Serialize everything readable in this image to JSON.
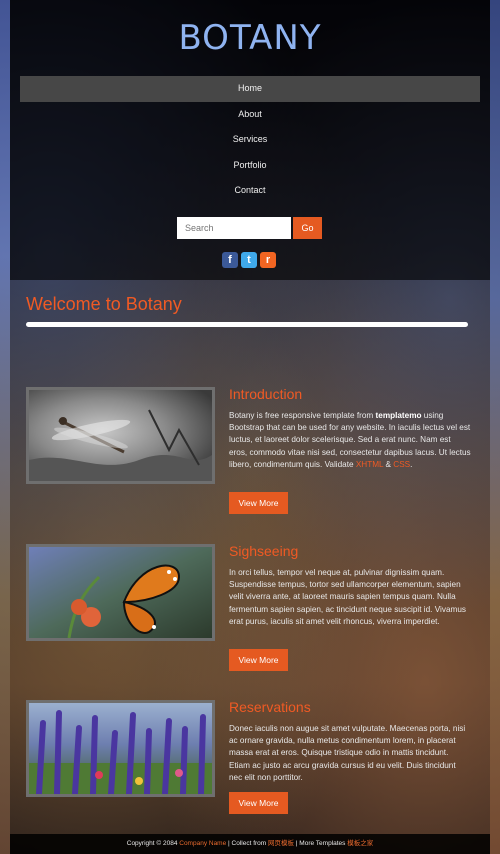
{
  "site": {
    "logo": "BOTANY"
  },
  "nav": [
    "Home",
    "About",
    "Services",
    "Portfolio",
    "Contact"
  ],
  "search": {
    "placeholder": "Search",
    "button": "Go"
  },
  "social": [
    {
      "icon": "facebook-icon",
      "glyph": "f"
    },
    {
      "icon": "twitter-icon",
      "glyph": "t"
    },
    {
      "icon": "rss-icon",
      "glyph": "r"
    }
  ],
  "welcome": "Welcome to Botany",
  "sections": [
    {
      "title": "Introduction",
      "text_before": "Botany is free responsive template from ",
      "text_bold": "templatemo",
      "text_after": " using Bootstrap that can be used for any website. In iaculis lectus vel est luctus, et laoreet dolor scelerisque. Sed a erat nunc. Nam est eros, commodo vitae nisi sed, consectetur dapibus lacus. Ut lectus libero, condimentum quis. Validate ",
      "link1": "XHTML",
      "joiner": " & ",
      "link2": "CSS",
      "text_end": ".",
      "button": "View More"
    },
    {
      "title": "Sighseeing",
      "text": "In orci tellus, tempor vel neque at, pulvinar dignissim quam. Suspendisse tempus, tortor sed ullamcorper elementum, sapien velit viverra ante, at laoreet mauris sapien tempus quam. Nulla fermentum sapien sapien, ac tincidunt neque suscipit id. Vivamus erat purus, iaculis sit amet velit rhoncus, viverra imperdiet.",
      "button": "View More"
    },
    {
      "title": "Reservations",
      "text": "Donec iaculis non augue sit amet vulputate. Maecenas porta, nisi ac ornare gravida, nulla metus condimentum lorem, in placerat massa erat at eros. Quisque tristique odio in mattis tincidunt. Etiam ac justo ac arcu gravida cursus id eu velit. Duis tincidunt nec elit non porttitor.",
      "button": "View More"
    }
  ],
  "footer": {
    "copyright": "Copyright © 2084 ",
    "company": "Company Name",
    "collect": " | Collect from ",
    "collect_link": "网页模板",
    "more": " | More Templates ",
    "more_link": "模板之家"
  },
  "colors": {
    "accent": "#e55a21",
    "logo": "#8fb3f0",
    "nav_active": "#474747"
  }
}
